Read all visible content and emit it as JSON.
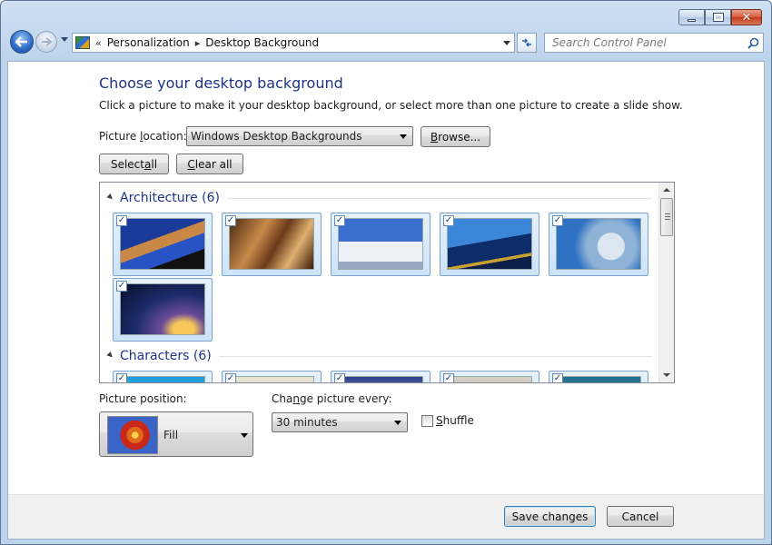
{
  "window": {
    "caption_buttons": {
      "minimize_icon": "minimize-icon",
      "maximize_icon": "maximize-icon",
      "close_icon": "close-icon"
    }
  },
  "navbar": {
    "breadcrumb": [
      "Personalization",
      "Desktop Background"
    ],
    "breadcrumb_prefix": "«",
    "separator": "▸",
    "search_placeholder": "Search Control Panel"
  },
  "main": {
    "title": "Choose your desktop background",
    "subtitle": "Click a picture to make it your desktop background, or select more than one picture to create a slide show.",
    "picture_location_label_pre": "Picture ",
    "picture_location_label_u": "l",
    "picture_location_label_post": "ocation:",
    "picture_location_value": "Windows Desktop Backgrounds",
    "browse_pre": "",
    "browse_u": "B",
    "browse_post": "rowse...",
    "select_all_pre": "Select ",
    "select_all_u": "a",
    "select_all_post": "ll",
    "clear_all_pre": "",
    "clear_all_u": "C",
    "clear_all_post": "lear all"
  },
  "groups": [
    {
      "name": "Architecture (6)",
      "checked": true
    },
    {
      "name": "Characters (6)",
      "checked": true
    }
  ],
  "picture_position": {
    "label": "Picture position:",
    "value": "Fill"
  },
  "change_picture": {
    "label_pre": "Cha",
    "label_u": "n",
    "label_post": "ge picture every:",
    "value": "30 minutes"
  },
  "shuffle": {
    "label_u": "S",
    "label_post": "huffle",
    "checked": false
  },
  "footer": {
    "save_label": "Save changes",
    "cancel_label": "Cancel"
  }
}
